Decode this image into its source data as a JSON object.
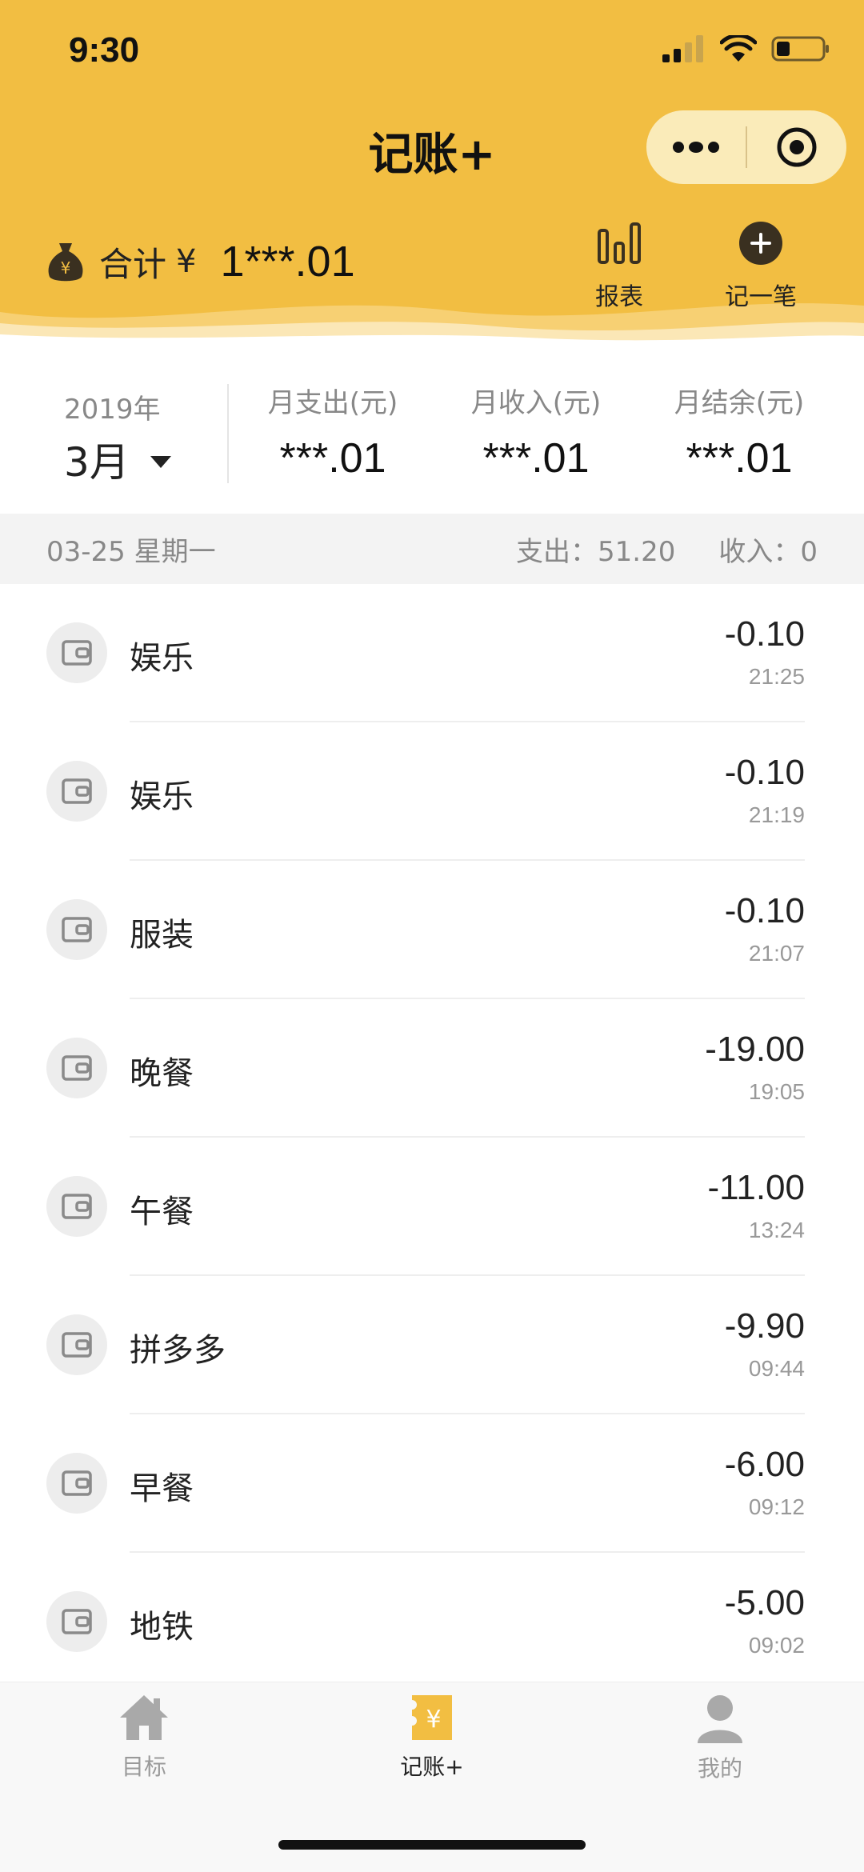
{
  "status_bar": {
    "time": "9:30"
  },
  "app": {
    "title": "记账+"
  },
  "header": {
    "total_label": "合计",
    "total_currency": "¥",
    "total_value": "1***.01",
    "report_label": "报表",
    "add_label": "记一笔"
  },
  "summary": {
    "year": "2019年",
    "month": "3月",
    "stats": [
      {
        "label": "月支出(元)",
        "value": "***.01"
      },
      {
        "label": "月收入(元)",
        "value": "***.01"
      },
      {
        "label": "月结余(元)",
        "value": "***.01"
      }
    ]
  },
  "day": {
    "date": "03-25 星期一",
    "expense": "支出：51.20",
    "income": "收入：0"
  },
  "records": [
    {
      "name": "娱乐",
      "amount": "-0.10",
      "time": "21:25"
    },
    {
      "name": "娱乐",
      "amount": "-0.10",
      "time": "21:19"
    },
    {
      "name": "服装",
      "amount": "-0.10",
      "time": "21:07"
    },
    {
      "name": "晚餐",
      "amount": "-19.00",
      "time": "19:05"
    },
    {
      "name": "午餐",
      "amount": "-11.00",
      "time": "13:24"
    },
    {
      "name": "拼多多",
      "amount": "-9.90",
      "time": "09:44"
    },
    {
      "name": "早餐",
      "amount": "-6.00",
      "time": "09:12"
    },
    {
      "name": "地铁",
      "amount": "-5.00",
      "time": "09:02"
    }
  ],
  "tabs": [
    {
      "label": "目标",
      "icon": "home-icon",
      "active": false
    },
    {
      "label": "记账+",
      "icon": "ledger-icon",
      "active": true
    },
    {
      "label": "我的",
      "icon": "user-icon",
      "active": false
    }
  ],
  "colors": {
    "brand": "#F2BE42",
    "capsule": "#FAEBB9",
    "tab_inactive": "#9A9A9A",
    "tab_active": "#222222"
  }
}
